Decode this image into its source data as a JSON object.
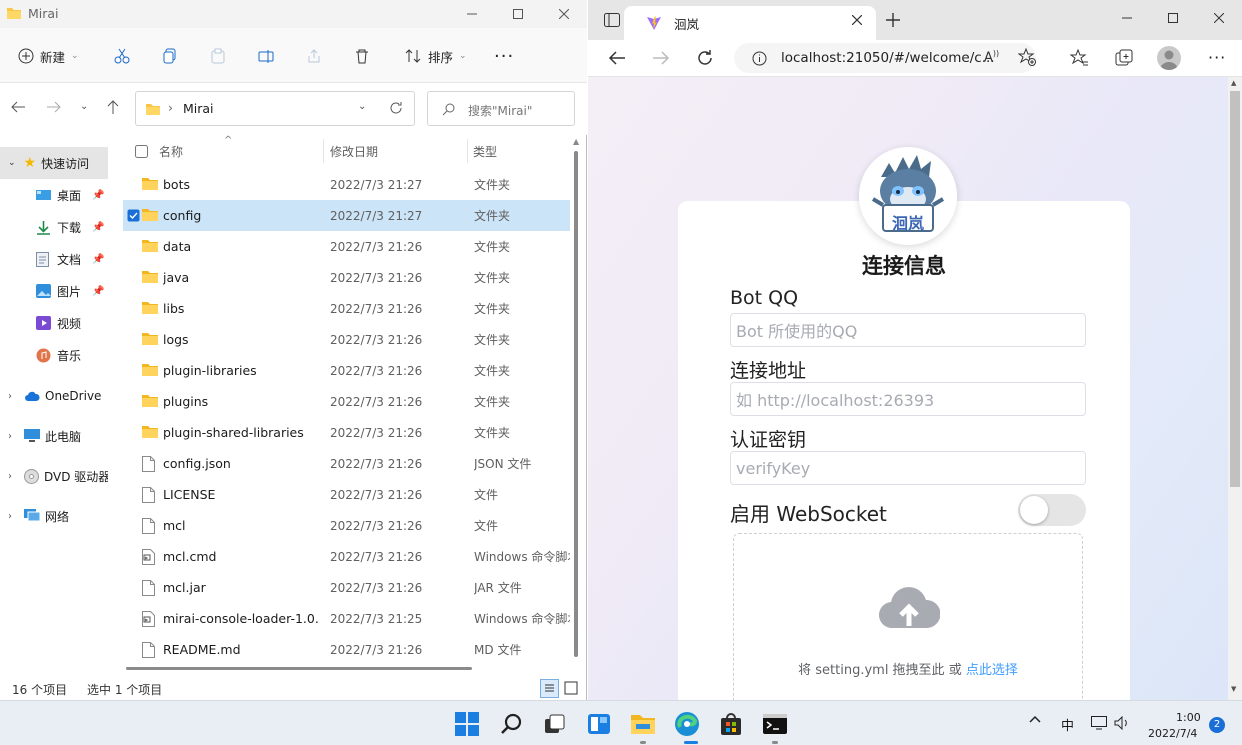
{
  "explorer": {
    "window_title": "Mirai",
    "toolbar": {
      "new_label": "新建",
      "sort_label": "排序"
    },
    "address": {
      "path": "Mirai",
      "search_placeholder": "搜索\"Mirai\""
    },
    "nav": {
      "quick_access": "快速访问",
      "items": [
        {
          "label": "桌面",
          "icon": "desktop-icon"
        },
        {
          "label": "下载",
          "icon": "download-icon"
        },
        {
          "label": "文档",
          "icon": "documents-icon"
        },
        {
          "label": "图片",
          "icon": "pictures-icon"
        },
        {
          "label": "视频",
          "icon": "videos-icon"
        },
        {
          "label": "音乐",
          "icon": "music-icon"
        }
      ],
      "onedrive": "OneDrive",
      "this_pc": "此电脑",
      "dvd": "DVD 驱动器",
      "network": "网络"
    },
    "columns": {
      "name": "名称",
      "date": "修改日期",
      "type": "类型"
    },
    "files": [
      {
        "name": "bots",
        "date": "2022/7/3 21:27",
        "type": "文件夹",
        "kind": "folder"
      },
      {
        "name": "config",
        "date": "2022/7/3 21:27",
        "type": "文件夹",
        "kind": "folder",
        "selected": true
      },
      {
        "name": "data",
        "date": "2022/7/3 21:26",
        "type": "文件夹",
        "kind": "folder"
      },
      {
        "name": "java",
        "date": "2022/7/3 21:26",
        "type": "文件夹",
        "kind": "folder"
      },
      {
        "name": "libs",
        "date": "2022/7/3 21:26",
        "type": "文件夹",
        "kind": "folder"
      },
      {
        "name": "logs",
        "date": "2022/7/3 21:26",
        "type": "文件夹",
        "kind": "folder"
      },
      {
        "name": "plugin-libraries",
        "date": "2022/7/3 21:26",
        "type": "文件夹",
        "kind": "folder"
      },
      {
        "name": "plugins",
        "date": "2022/7/3 21:26",
        "type": "文件夹",
        "kind": "folder"
      },
      {
        "name": "plugin-shared-libraries",
        "date": "2022/7/3 21:26",
        "type": "文件夹",
        "kind": "folder"
      },
      {
        "name": "config.json",
        "date": "2022/7/3 21:26",
        "type": "JSON 文件",
        "kind": "file"
      },
      {
        "name": "LICENSE",
        "date": "2022/7/3 21:26",
        "type": "文件",
        "kind": "file"
      },
      {
        "name": "mcl",
        "date": "2022/7/3 21:26",
        "type": "文件",
        "kind": "file"
      },
      {
        "name": "mcl.cmd",
        "date": "2022/7/3 21:26",
        "type": "Windows 命令脚本",
        "kind": "cmd"
      },
      {
        "name": "mcl.jar",
        "date": "2022/7/3 21:26",
        "type": "JAR 文件",
        "kind": "file"
      },
      {
        "name": "mirai-console-loader-1.0...",
        "date": "2022/7/3 21:25",
        "type": "Windows 命令脚本",
        "kind": "cmd"
      },
      {
        "name": "README.md",
        "date": "2022/7/3 21:26",
        "type": "MD 文件",
        "kind": "file"
      }
    ],
    "status": {
      "count": "16 个项目",
      "selected": "选中 1 个项目"
    }
  },
  "browser": {
    "tab_title": "洄岚",
    "url": "localhost:21050/#/welcome/c...",
    "form": {
      "avatar_text": "洄岚",
      "title": "连接信息",
      "bot_qq_label": "Bot QQ",
      "bot_qq_placeholder": "Bot 所使用的QQ",
      "address_label": "连接地址",
      "address_placeholder": "如 http://localhost:26393",
      "key_label": "认证密钥",
      "key_placeholder": "verifyKey",
      "websocket_label": "启用 WebSocket",
      "websocket_enabled": false,
      "upload_text": "将 setting.yml 拖拽至此 或",
      "upload_link": "点此选择"
    },
    "colors": {
      "link": "#409eff"
    }
  },
  "taskbar": {
    "ime": "中",
    "time": "1:00",
    "date": "2022/7/4",
    "notifications": "2"
  }
}
